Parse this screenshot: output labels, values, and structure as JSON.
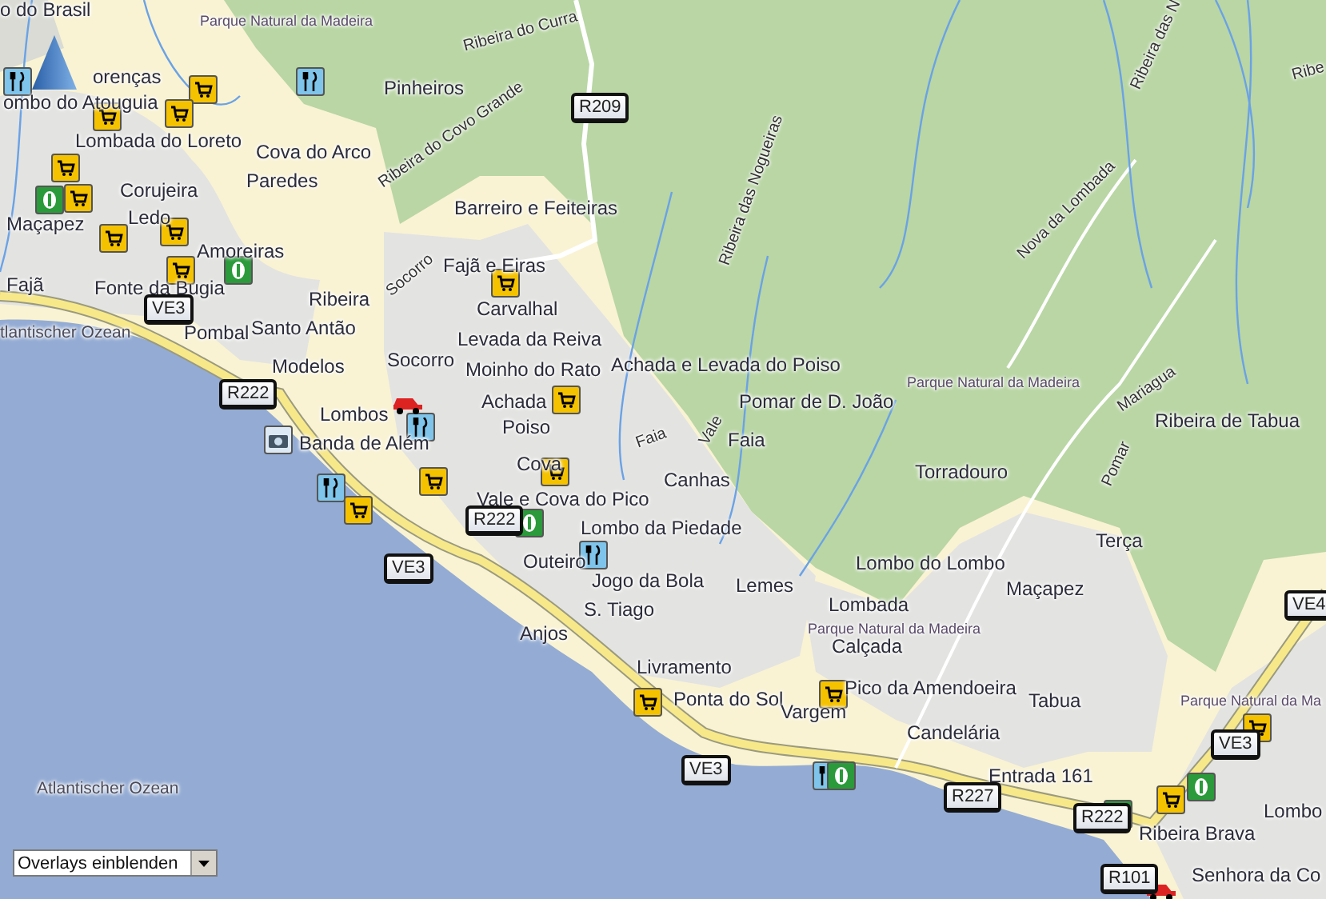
{
  "map": {
    "labels": [
      {
        "text": "o do Brasil",
        "kind": "town"
      },
      {
        "text": "Parque Natural da Madeira",
        "kind": "park"
      },
      {
        "text": "Ribeira do Curra",
        "kind": "stream"
      },
      {
        "text": "orenças",
        "kind": "town"
      },
      {
        "text": "ombo do Atouguia",
        "kind": "town"
      },
      {
        "text": "Pinheiros",
        "kind": "town"
      },
      {
        "text": "Lombada do Loreto",
        "kind": "town"
      },
      {
        "text": "Cova do Arco",
        "kind": "town"
      },
      {
        "text": "Paredes",
        "kind": "town"
      },
      {
        "text": "Ribeira do Covo Grande",
        "kind": "stream"
      },
      {
        "text": "Corujeira",
        "kind": "town"
      },
      {
        "text": "Barreiro e Feiteiras",
        "kind": "town"
      },
      {
        "text": "Ledo",
        "kind": "town"
      },
      {
        "text": "Maçapez",
        "kind": "town"
      },
      {
        "text": "Amoreiras",
        "kind": "town"
      },
      {
        "text": "Fajã e Eiras",
        "kind": "town"
      },
      {
        "text": "Socorro",
        "kind": "stream"
      },
      {
        "text": "Fajã",
        "kind": "town"
      },
      {
        "text": "Fonte da Bugia",
        "kind": "town"
      },
      {
        "text": "Ribeira",
        "kind": "town"
      },
      {
        "text": "Carvalhal",
        "kind": "town"
      },
      {
        "text": "tlantischer Ozean",
        "kind": "sea"
      },
      {
        "text": "Pombal",
        "kind": "town"
      },
      {
        "text": "Santo Antão",
        "kind": "town"
      },
      {
        "text": "Levada da Reiva",
        "kind": "town"
      },
      {
        "text": "Modelos",
        "kind": "town"
      },
      {
        "text": "Socorro",
        "kind": "town"
      },
      {
        "text": "Moinho do Rato",
        "kind": "town"
      },
      {
        "text": "Achada e Levada do Poiso",
        "kind": "town"
      },
      {
        "text": "Parque Natural da Madeira",
        "kind": "park"
      },
      {
        "text": "Nova da Lombada",
        "kind": "stream"
      },
      {
        "text": "Ribeira das Nogueiras",
        "kind": "stream"
      },
      {
        "text": "Ribeira das N",
        "kind": "stream"
      },
      {
        "text": "Ribe",
        "kind": "stream"
      },
      {
        "text": "Achada",
        "kind": "town"
      },
      {
        "text": "Pomar de D. João",
        "kind": "town"
      },
      {
        "text": "Vale",
        "kind": "stream"
      },
      {
        "text": "Lombos",
        "kind": "town"
      },
      {
        "text": "Mariagua",
        "kind": "stream"
      },
      {
        "text": "Ribeira de Tabua",
        "kind": "town"
      },
      {
        "text": "Poiso",
        "kind": "town"
      },
      {
        "text": "Faia",
        "kind": "stream"
      },
      {
        "text": "Faia",
        "kind": "town"
      },
      {
        "text": "Banda de Além",
        "kind": "town"
      },
      {
        "text": "Pomar",
        "kind": "stream"
      },
      {
        "text": "Cova",
        "kind": "town"
      },
      {
        "text": "Canhas",
        "kind": "town"
      },
      {
        "text": "Torradouro",
        "kind": "town"
      },
      {
        "text": "Vale e Cova do Pico",
        "kind": "town"
      },
      {
        "text": "Lombo da Piedade",
        "kind": "town"
      },
      {
        "text": "Terça",
        "kind": "town"
      },
      {
        "text": "Outeiro",
        "kind": "town"
      },
      {
        "text": "Lombo do Lombo",
        "kind": "town"
      },
      {
        "text": "Jogo da Bola",
        "kind": "town"
      },
      {
        "text": "Lemes",
        "kind": "town"
      },
      {
        "text": "Maçapez",
        "kind": "town"
      },
      {
        "text": "S. Tiago",
        "kind": "town"
      },
      {
        "text": "Lombada",
        "kind": "town"
      },
      {
        "text": "Anjos",
        "kind": "town"
      },
      {
        "text": "Parque Natural da Madeira",
        "kind": "park"
      },
      {
        "text": "Calçada",
        "kind": "town"
      },
      {
        "text": "Livramento",
        "kind": "town"
      },
      {
        "text": "Ponta do Sol",
        "kind": "town"
      },
      {
        "text": "Vargem",
        "kind": "town"
      },
      {
        "text": "Pico da Amendoeira",
        "kind": "town"
      },
      {
        "text": "Tabua",
        "kind": "town"
      },
      {
        "text": "Parque Natural da Ma",
        "kind": "park"
      },
      {
        "text": "Candelária",
        "kind": "town"
      },
      {
        "text": "Entrada 161",
        "kind": "town"
      },
      {
        "text": "Atlantischer Ozean",
        "kind": "sea"
      },
      {
        "text": "Lombo",
        "kind": "town"
      },
      {
        "text": "Ribeira Brava",
        "kind": "town"
      },
      {
        "text": "Senhora da Co",
        "kind": "town"
      }
    ],
    "road_shields": [
      {
        "text": "VE3"
      },
      {
        "text": "R222"
      },
      {
        "text": "R209"
      },
      {
        "text": "R222"
      },
      {
        "text": "VE3"
      },
      {
        "text": "VE3"
      },
      {
        "text": "R227"
      },
      {
        "text": "R222"
      },
      {
        "text": "R101"
      },
      {
        "text": "VE3"
      },
      {
        "text": "VE4"
      }
    ],
    "overlay_select": {
      "value": "Overlays einblenden"
    }
  }
}
